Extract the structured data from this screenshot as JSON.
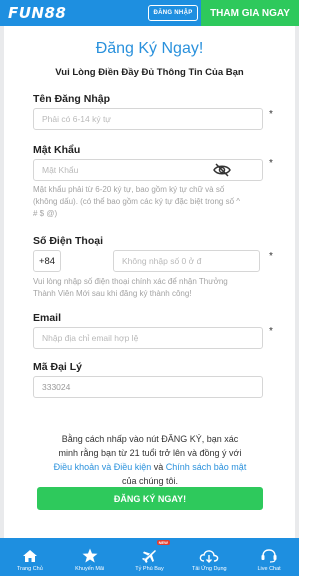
{
  "header": {
    "logo": "FUN88",
    "login_label": "ĐĂNG NHẬP",
    "join_label": "THAM GIA NGAY"
  },
  "form": {
    "title": "Đăng Ký Ngay!",
    "subtitle": "Vui Lòng Điền Đầy Đủ Thông Tin Của Bạn",
    "username": {
      "label": "Tên Đăng Nhập",
      "placeholder": "Phải có 6-14 ký tự",
      "required_mark": "*"
    },
    "password": {
      "label": "Mật Khẩu",
      "placeholder": "Mật Khẩu",
      "required_mark": "*",
      "help_line1": "Mật khẩu phải từ 6-20 ký tự, bao gồm ký tự chữ và số",
      "help_line2": "(không dấu). (có thể bao gồm các ký tự đặc biệt trong số ^",
      "help_line3": "# $ @)"
    },
    "phone": {
      "label": "Số Điện Thoại",
      "prefix": "+84",
      "placeholder": "Không nhập số 0 ở đ",
      "required_mark": "*",
      "help_line1": "Vui lòng nhập số điện thoại chính xác để nhận Thưởng",
      "help_line2": "Thành Viên Mới sau khi đăng ký thành công!"
    },
    "email": {
      "label": "Email",
      "placeholder": "Nhập địa chỉ email hợp lệ",
      "required_mark": "*"
    },
    "agent_code": {
      "label": "Mã Đại Lý",
      "value": "333024"
    },
    "terms": {
      "line1": "Bằng cách nhấp vào nút ĐĂNG KÝ, bạn xác",
      "line2": "minh rằng bạn từ 21 tuổi trở lên và đồng ý với",
      "terms_link": "Điều khoản và Điều kiện",
      "and": "và",
      "privacy_link": "Chính sách bảo mật",
      "line4": "của chúng tôi."
    },
    "submit_label": "ĐĂNG KÝ NGAY!"
  },
  "bottom_nav": {
    "items": [
      {
        "label": "Trang Chủ",
        "icon": "home-icon"
      },
      {
        "label": "Khuyến Mãi",
        "icon": "star-icon"
      },
      {
        "label": "Tỷ Phú Bay",
        "icon": "plane-icon",
        "badge": "NEW"
      },
      {
        "label": "Tải Ứng Dụng",
        "icon": "cloud-download-icon"
      },
      {
        "label": "Live Chat",
        "icon": "chat-icon"
      }
    ]
  },
  "colors": {
    "brand_blue": "#1e8fe0",
    "accent_green": "#2ec95c",
    "link_blue": "#2a91dc"
  }
}
